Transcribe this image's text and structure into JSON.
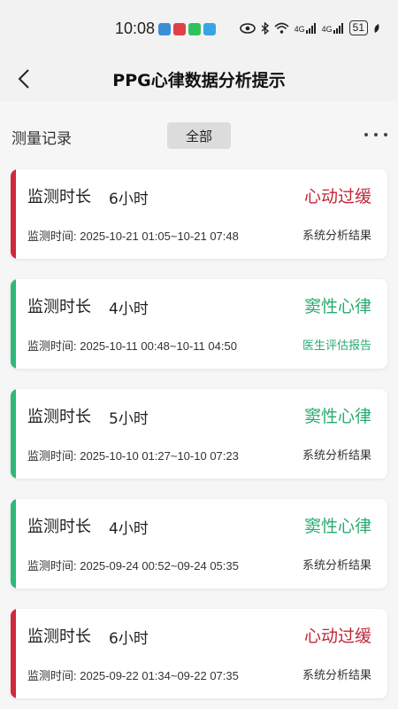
{
  "status_bar": {
    "time": "10:08",
    "signal_a": "4G",
    "signal_b": "4G",
    "battery": "51"
  },
  "header": {
    "title": "PPG心律数据分析提示"
  },
  "filter": {
    "label": "测量记录",
    "chip": "全部"
  },
  "colors": {
    "red": "#d0283c",
    "green": "#2fb87a",
    "red_text": "#c02738",
    "green_text": "#2aaa72"
  },
  "records": [
    {
      "duration_label": "监测时长",
      "duration": "6小时",
      "result": "心动过缓",
      "time": "监测时间: 2025-10-21 01:05~10-21 07:48",
      "source": "系统分析结果",
      "status": "red"
    },
    {
      "duration_label": "监测时长",
      "duration": "4小时",
      "result": "窦性心律",
      "time": "监测时间: 2025-10-11 00:48~10-11 04:50",
      "source": "医生评估报告",
      "status": "green"
    },
    {
      "duration_label": "监测时长",
      "duration": "5小时",
      "result": "窦性心律",
      "time": "监测时间: 2025-10-10 01:27~10-10 07:23",
      "source": "系统分析结果",
      "status": "green"
    },
    {
      "duration_label": "监测时长",
      "duration": "4小时",
      "result": "窦性心律",
      "time": "监测时间: 2025-09-24 00:52~09-24 05:35",
      "source": "系统分析结果",
      "status": "green"
    },
    {
      "duration_label": "监测时长",
      "duration": "6小时",
      "result": "心动过缓",
      "time": "监测时间: 2025-09-22 01:34~09-22 07:35",
      "source": "系统分析结果",
      "status": "red"
    }
  ]
}
